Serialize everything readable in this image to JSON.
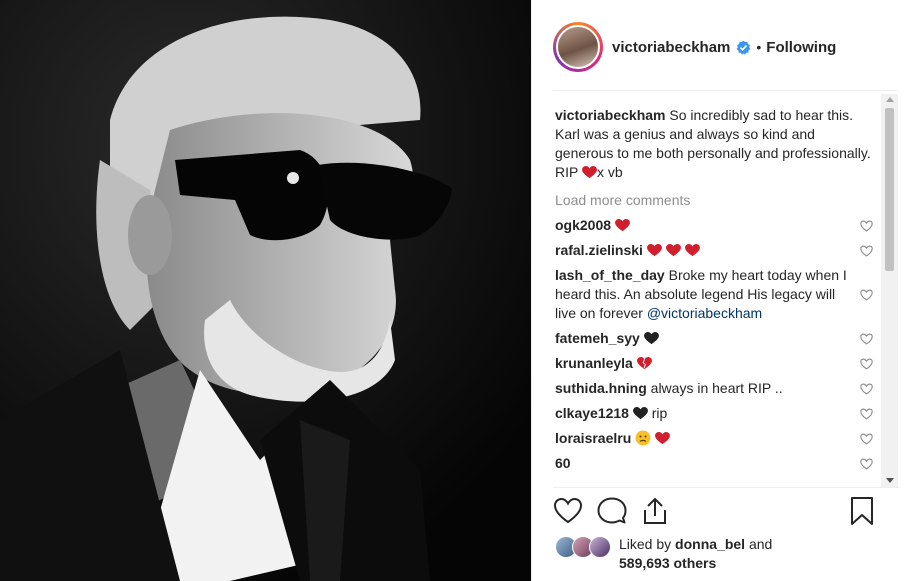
{
  "post": {
    "author": "victoriabeckham",
    "follow_status": "Following",
    "dot": "•",
    "caption_user": "victoriabeckham",
    "caption_text": "So incredibly sad to hear this. Karl was a genius and always so kind and generous to me both personally and professionally. RIP",
    "caption_end": "x vb"
  },
  "comments_ui": {
    "load_more": "Load more comments"
  },
  "comments": [
    {
      "user": "ogk2008",
      "text": ""
    },
    {
      "user": "rafal.zielinski",
      "text": ""
    },
    {
      "user": "lash_of_the_day",
      "text": "Broke my heart today when I heard this. An absolute legend His legacy will live on forever",
      "mention": "@victoriabeckham"
    },
    {
      "user": "fatemeh_syy",
      "text": ""
    },
    {
      "user": "krunanleyla",
      "text": ""
    },
    {
      "user": "suthida.hning",
      "text": "always in heart RIP .."
    },
    {
      "user": "clkaye1218",
      "text": "rip"
    },
    {
      "user": "loraisraelru",
      "text": ""
    },
    {
      "user": "60",
      "text": ""
    }
  ],
  "likes": {
    "prefix": "Liked by",
    "user": "donna_bel",
    "and": "and",
    "count": "589,693 others"
  },
  "icons": [
    "heart-icon",
    "comment-icon",
    "share-icon",
    "bookmark-icon",
    "verified-badge-icon",
    "red-heart-emoji",
    "black-heart-emoji",
    "sad-face-emoji"
  ],
  "colors": {
    "accent_red": "#ed4956",
    "verified_blue": "#3897f0",
    "text": "#262626",
    "muted": "#8e8e8e"
  }
}
